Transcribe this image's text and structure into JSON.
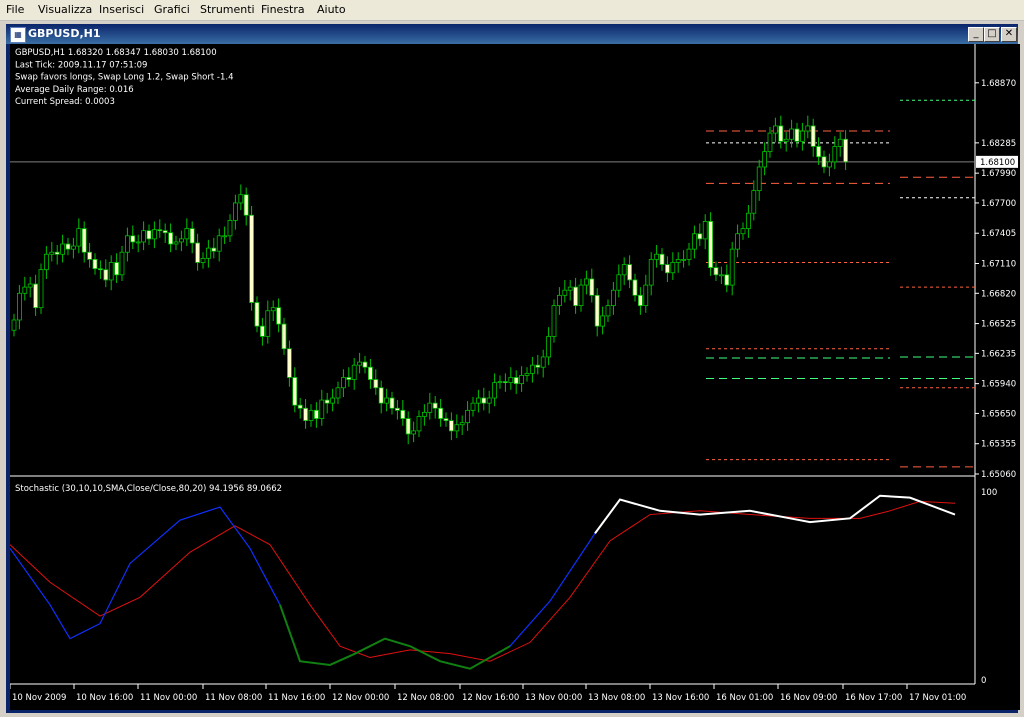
{
  "menu": [
    "File",
    "Visualizza",
    "Inserisci",
    "Grafici",
    "Strumenti",
    "Finestra",
    "Aiuto"
  ],
  "window": {
    "title": "GBPUSD,H1",
    "icon": "chart-window-icon"
  },
  "info": [
    "GBPUSD,H1  1.68320 1.68347 1.68030 1.68100",
    "Last Tick: 2009.11.17 07:51:09",
    "Swap favors longs, Swap Long 1.2, Swap Short -1.4",
    "Average Daily Range: 0.016",
    "Current Spread: 0.0003"
  ],
  "price_axis": [
    "1.68870",
    "1.68285",
    "1.67990",
    "1.67700",
    "1.67405",
    "1.67110",
    "1.66820",
    "1.66525",
    "1.66235",
    "1.65940",
    "1.65650",
    "1.65355",
    "1.65060"
  ],
  "current_price": "1.68100",
  "indicator": {
    "label": "Stochastic (30,10,10,SMA,Close/Close,80,20) 94.1956 89.0662",
    "axis_top": "100",
    "axis_bottom": "0"
  },
  "time_axis": [
    "10 Nov 2009",
    "10 Nov 16:00",
    "11 Nov 00:00",
    "11 Nov 08:00",
    "11 Nov 16:00",
    "12 Nov 00:00",
    "12 Nov 08:00",
    "12 Nov 16:00",
    "13 Nov 00:00",
    "13 Nov 08:00",
    "13 Nov 16:00",
    "16 Nov 01:00",
    "16 Nov 09:00",
    "16 Nov 17:00",
    "17 Nov 01:00"
  ],
  "colors": {
    "bull": "#000000",
    "bear": "#ffffcc",
    "candle_outline": "#00c000",
    "main_line": "#1030ff",
    "signal_line": "#e01010",
    "overbought_line": "#ffffff",
    "oversold_line": "#108010",
    "level_red": "#ff6040",
    "level_green": "#40ff80"
  },
  "chart_data": {
    "type": "candlestick",
    "symbol": "GBPUSD",
    "timeframe": "H1",
    "ylim": [
      1.6506,
      1.6917
    ],
    "close": [
      1.6656,
      1.6682,
      1.6688,
      1.6691,
      1.6668,
      1.6705,
      1.672,
      1.6722,
      1.672,
      1.673,
      1.6725,
      1.6728,
      1.6745,
      1.6722,
      1.6715,
      1.6706,
      1.6705,
      1.6695,
      1.6712,
      1.67,
      1.6722,
      1.6738,
      1.6732,
      1.6732,
      1.6743,
      1.6735,
      1.6744,
      1.6743,
      1.6741,
      1.673,
      1.6732,
      1.6735,
      1.6745,
      1.6731,
      1.6712,
      1.6716,
      1.6726,
      1.6723,
      1.6738,
      1.6738,
      1.6753,
      1.677,
      1.6778,
      1.6758,
      1.6673,
      1.665,
      1.664,
      1.6665,
      1.6668,
      1.6652,
      1.6628,
      1.66,
      1.6573,
      1.657,
      1.6558,
      1.6568,
      1.656,
      1.6578,
      1.6575,
      1.658,
      1.659,
      1.66,
      1.6598,
      1.6612,
      1.6615,
      1.661,
      1.6598,
      1.659,
      1.6575,
      1.658,
      1.657,
      1.6568,
      1.656,
      1.6545,
      1.6548,
      1.6562,
      1.6566,
      1.6575,
      1.657,
      1.656,
      1.6558,
      1.6548,
      1.6554,
      1.6556,
      1.6568,
      1.6575,
      1.658,
      1.6575,
      1.658,
      1.6595,
      1.6596,
      1.6595,
      1.66,
      1.6594,
      1.6602,
      1.6604,
      1.6612,
      1.661,
      1.662,
      1.664,
      1.667,
      1.668,
      1.6685,
      1.6688,
      1.667,
      1.669,
      1.6696,
      1.668,
      1.665,
      1.666,
      1.667,
      1.6685,
      1.67,
      1.671,
      1.6695,
      1.668,
      1.667,
      1.669,
      1.6715,
      1.672,
      1.671,
      1.6702,
      1.6712,
      1.6715,
      1.6715,
      1.6725,
      1.674,
      1.6735,
      1.6752,
      1.6707,
      1.67,
      1.67,
      1.669,
      1.6725,
      1.674,
      1.6745,
      1.676,
      1.6782,
      1.6805,
      1.682,
      1.6838,
      1.6845,
      1.683,
      1.6832,
      1.6842,
      1.683,
      1.684,
      1.6845,
      1.6825,
      1.6815,
      1.6805,
      1.681,
      1.6825,
      1.6832,
      1.681
    ]
  }
}
